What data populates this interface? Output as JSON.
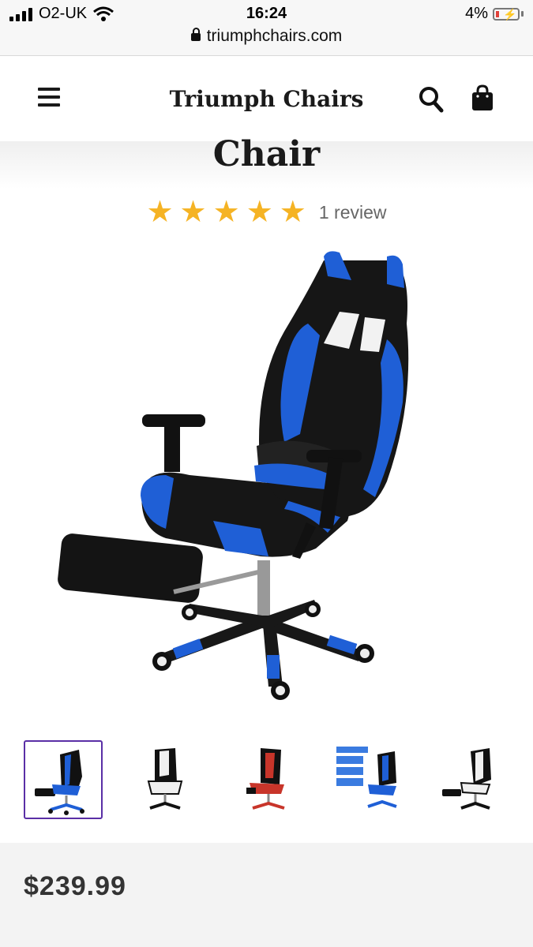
{
  "status": {
    "carrier": "O2-UK",
    "time": "16:24",
    "battery": "4%"
  },
  "browser": {
    "url": "triumphchairs.com"
  },
  "header": {
    "brand": "Triumph Chairs"
  },
  "product": {
    "title": "Chair",
    "rating_stars": 5,
    "review_text": "1 review",
    "price": "$239.99",
    "images": [
      {
        "variant": "black-blue",
        "selected": true
      },
      {
        "variant": "black-white",
        "selected": false
      },
      {
        "variant": "black-red",
        "selected": false
      },
      {
        "variant": "black-blue-annotated",
        "selected": false,
        "caption_lines": [
          "OFFICE CHAIR",
          "90-155° ROCKING",
          "RETRACTABLE FOOTREST",
          "NECK & LUMBAR PILLOW"
        ]
      },
      {
        "variant": "black-white-footrest",
        "selected": false
      }
    ]
  },
  "colors": {
    "accent": "#5a2fa6",
    "star": "#f5b324",
    "chair_blue": "#1f5fd6",
    "chair_red": "#c8352a"
  }
}
